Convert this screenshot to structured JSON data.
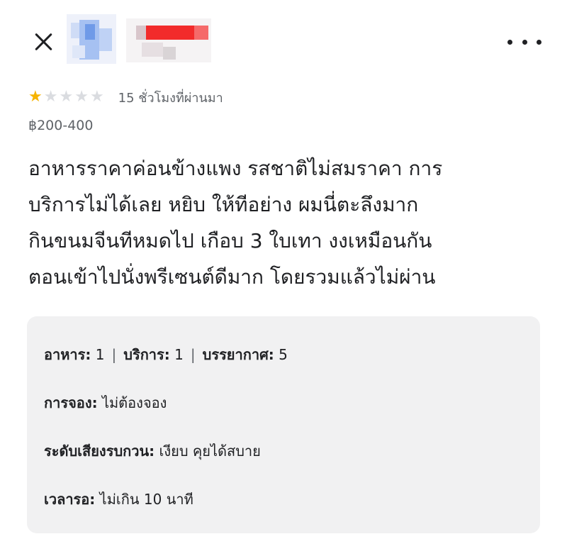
{
  "header": {
    "close_icon": "close-icon",
    "more_icon": "more-options-icon"
  },
  "review": {
    "rating": 1,
    "max_rating": 5,
    "time_ago": "15 ชั่วโมงที่ผ่านมา",
    "price_range": "฿200-400",
    "lines": [
      "อาหารราคาค่อนข้างแพง รสชาติไม่สมราคา การ",
      "บริการไม่ได้เลย หยิบ ให้ทีอย่าง ผมนี่ตะลึงมาก",
      "กินขนมจีนทีหมดไป เกือบ 3 ใบเทา งงเหมือนกัน",
      "ตอนเข้าไปนั่งพรีเซนต์ดีมาก โดยรวมแล้วไม่ผ่าน"
    ]
  },
  "details": {
    "food_label": "อาหาร:",
    "food_value": "1",
    "service_label": "บริการ:",
    "service_value": "1",
    "atmosphere_label": "บรรยากาศ:",
    "atmosphere_value": "5",
    "reservation_label": "การจอง:",
    "reservation_value": "ไม่ต้องจอง",
    "noise_label": "ระดับเสียงรบกวน:",
    "noise_value": "เงียบ คุยได้สบาย",
    "wait_label": "เวลารอ:",
    "wait_value": "ไม่เกิน 10 นาที"
  },
  "colors": {
    "star_filled": "#f6b400",
    "star_empty": "#dadce0",
    "panel_bg": "#f1f1f2",
    "text": "#202124",
    "muted": "#5f6368"
  }
}
